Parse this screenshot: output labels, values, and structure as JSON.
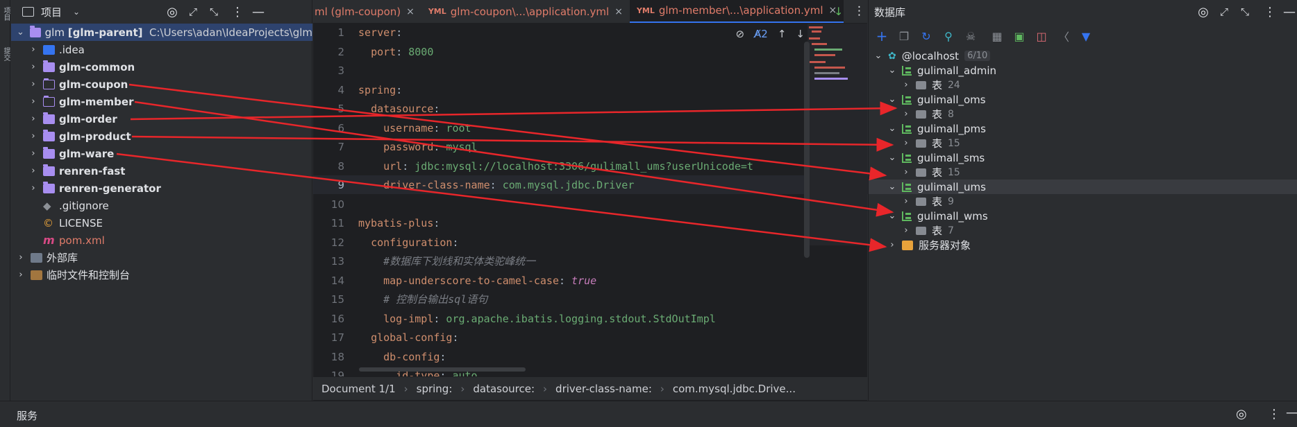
{
  "left_stripe": {
    "items": [
      "项目",
      "提交"
    ]
  },
  "project": {
    "header_title": "项目",
    "root": {
      "name": "glm",
      "module": "[glm-parent]",
      "path": "C:\\Users\\adan\\IdeaProjects\\glm"
    },
    "items": [
      {
        "label": ".idea",
        "type": "idea",
        "bold": false
      },
      {
        "label": "glm-common",
        "type": "module",
        "bold": true
      },
      {
        "label": "glm-coupon",
        "type": "folder",
        "bold": true
      },
      {
        "label": "glm-member",
        "type": "folder",
        "bold": true
      },
      {
        "label": "glm-order",
        "type": "module",
        "bold": true
      },
      {
        "label": "glm-product",
        "type": "module",
        "bold": true
      },
      {
        "label": "glm-ware",
        "type": "module",
        "bold": true
      },
      {
        "label": "renren-fast",
        "type": "module",
        "bold": true
      },
      {
        "label": "renren-generator",
        "type": "module",
        "bold": true
      },
      {
        "label": ".gitignore",
        "type": "file",
        "bold": false
      },
      {
        "label": "LICENSE",
        "type": "file",
        "bold": false
      },
      {
        "label": "pom.xml",
        "type": "file",
        "bold": false
      }
    ],
    "external_libs": "外部库",
    "scratches": "临时文件和控制台"
  },
  "editor": {
    "tabs": [
      {
        "label": "ml (glm-coupon)",
        "active": false
      },
      {
        "label": "glm-coupon\\...\\application.yml",
        "active": false
      },
      {
        "label": "glm-member\\...\\application.yml",
        "active": true
      }
    ],
    "inspections": "2",
    "line_numbers": [
      "1",
      "2",
      "3",
      "4",
      "5",
      "6",
      "7",
      "8",
      "9",
      "10",
      "11",
      "12",
      "13",
      "14",
      "15",
      "16",
      "17",
      "18",
      "19"
    ],
    "code": [
      {
        "key": "server",
        "indent": 0,
        "val": "",
        "type": "key"
      },
      {
        "key": "port",
        "indent": 1,
        "val": "8000",
        "type": "key"
      },
      {
        "key": "",
        "indent": 0,
        "val": "",
        "type": "blank"
      },
      {
        "key": "spring",
        "indent": 0,
        "val": "",
        "type": "key"
      },
      {
        "key": "datasource",
        "indent": 1,
        "val": "",
        "type": "key"
      },
      {
        "key": "username",
        "indent": 2,
        "val": "root",
        "type": "key"
      },
      {
        "key": "password",
        "indent": 2,
        "val": "mysql",
        "type": "key"
      },
      {
        "key": "url",
        "indent": 2,
        "val": "jdbc:mysql://localhost:3306/gulimall_ums?userUnicode=t",
        "type": "url"
      },
      {
        "key": "driver-class-name",
        "indent": 2,
        "val": "com.mysql.jdbc.Driver",
        "type": "key"
      },
      {
        "key": "",
        "indent": 0,
        "val": "",
        "type": "blank"
      },
      {
        "key": "mybatis-plus",
        "indent": 0,
        "val": "",
        "type": "key"
      },
      {
        "key": "configuration",
        "indent": 1,
        "val": "",
        "type": "key"
      },
      {
        "key": "#数据库下划线和实体类驼峰统一",
        "indent": 2,
        "val": "",
        "type": "comment"
      },
      {
        "key": "map-underscore-to-camel-case",
        "indent": 2,
        "val": "true",
        "type": "bool"
      },
      {
        "key": "# 控制台输出sql语句",
        "indent": 2,
        "val": "",
        "type": "comment"
      },
      {
        "key": "log-impl",
        "indent": 2,
        "val": "org.apache.ibatis.logging.stdout.StdOutImpl",
        "type": "key"
      },
      {
        "key": "global-config",
        "indent": 1,
        "val": "",
        "type": "key"
      },
      {
        "key": "db-config",
        "indent": 2,
        "val": "",
        "type": "key"
      },
      {
        "key": "id-type",
        "indent": 3,
        "val": "auto",
        "type": "key"
      }
    ],
    "breadcrumbs": [
      "Document 1/1",
      "spring:",
      "datasource:",
      "driver-class-name:",
      "com.mysql.jdbc.Drive..."
    ]
  },
  "database": {
    "header_title": "数据库",
    "host": "@localhost",
    "host_badge": "6/10",
    "schemas": [
      {
        "name": "gulimall_admin",
        "table_label": "表",
        "count": "24"
      },
      {
        "name": "gulimall_oms",
        "table_label": "表",
        "count": "8"
      },
      {
        "name": "gulimall_pms",
        "table_label": "表",
        "count": "15"
      },
      {
        "name": "gulimall_sms",
        "table_label": "表",
        "count": "15"
      },
      {
        "name": "gulimall_ums",
        "table_label": "表",
        "count": "9"
      },
      {
        "name": "gulimall_wms",
        "table_label": "表",
        "count": "7"
      }
    ],
    "server_objects": "服务器对象"
  },
  "bottom": {
    "title": "服务"
  }
}
